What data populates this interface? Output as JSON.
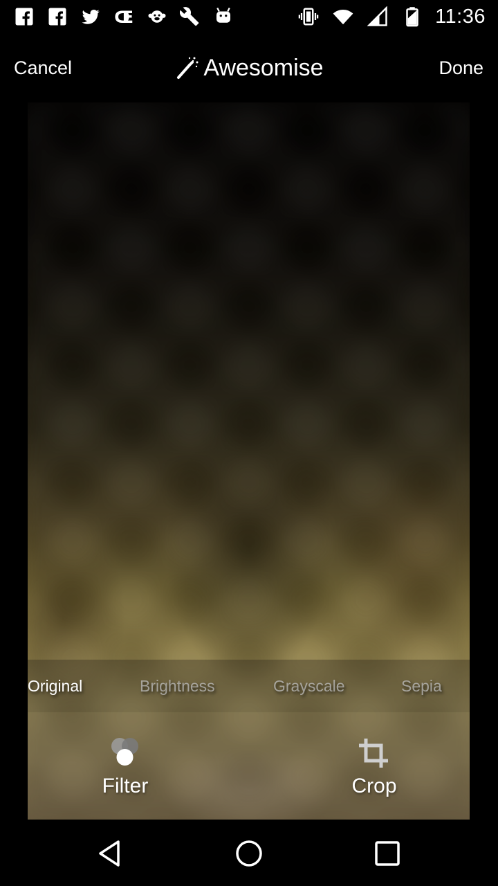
{
  "status_bar": {
    "time": "11:36",
    "left_icons": [
      "facebook-icon",
      "facebook-icon",
      "twitter-icon",
      "ce-icon",
      "monkey-icon",
      "wrench-icon",
      "android-icon"
    ],
    "right_icons": [
      "vibrate-icon",
      "wifi-icon",
      "cell-signal-icon",
      "battery-icon"
    ]
  },
  "action_bar": {
    "cancel_label": "Cancel",
    "title": "Awesomise",
    "done_label": "Done"
  },
  "filters": {
    "options": [
      {
        "label": "Original",
        "selected": true
      },
      {
        "label": "Brightness",
        "selected": false
      },
      {
        "label": "Grayscale",
        "selected": false
      },
      {
        "label": "Sepia",
        "selected": false
      }
    ]
  },
  "tools": {
    "filter_label": "Filter",
    "crop_label": "Crop"
  },
  "nav_bar": {
    "buttons": [
      "back",
      "home",
      "recents"
    ]
  },
  "colors": {
    "background": "#000000",
    "text": "#ffffff",
    "dim_text": "#bebebe"
  }
}
